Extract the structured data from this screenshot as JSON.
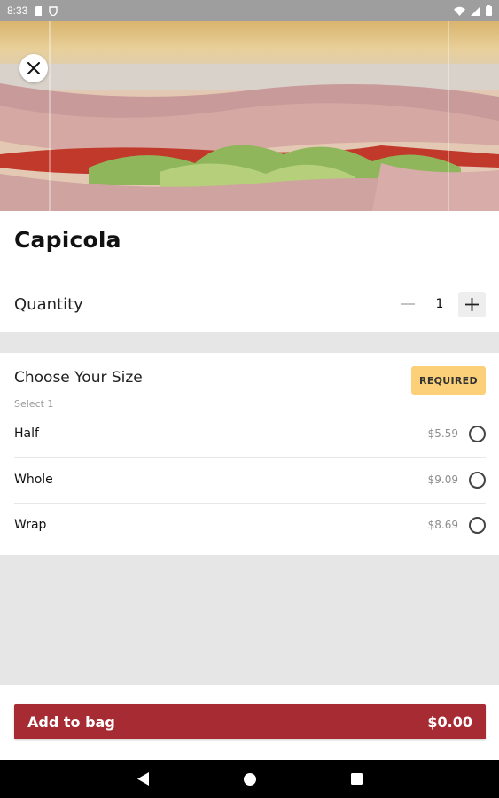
{
  "status_bar": {
    "time": "8:33"
  },
  "product": {
    "title": "Capicola"
  },
  "quantity": {
    "label": "Quantity",
    "value": "1"
  },
  "size_section": {
    "heading": "Choose Your Size",
    "subtext": "Select 1",
    "badge": "REQUIRED",
    "options": [
      {
        "name": "Half",
        "price": "$5.59",
        "selected": false
      },
      {
        "name": "Whole",
        "price": "$9.09",
        "selected": false
      },
      {
        "name": "Wrap",
        "price": "$8.69",
        "selected": false
      }
    ]
  },
  "add_to_bag": {
    "label": "Add to bag",
    "total": "$0.00"
  },
  "colors": {
    "accent": "#a62b33",
    "badge_bg": "#fbd079",
    "band": "#e6e6e6",
    "status_bar": "#9e9e9e"
  },
  "icons": {
    "close": "close-icon",
    "minus": "minus-icon",
    "plus": "plus-icon",
    "back": "back-icon",
    "home": "home-icon",
    "recents": "recents-icon"
  }
}
